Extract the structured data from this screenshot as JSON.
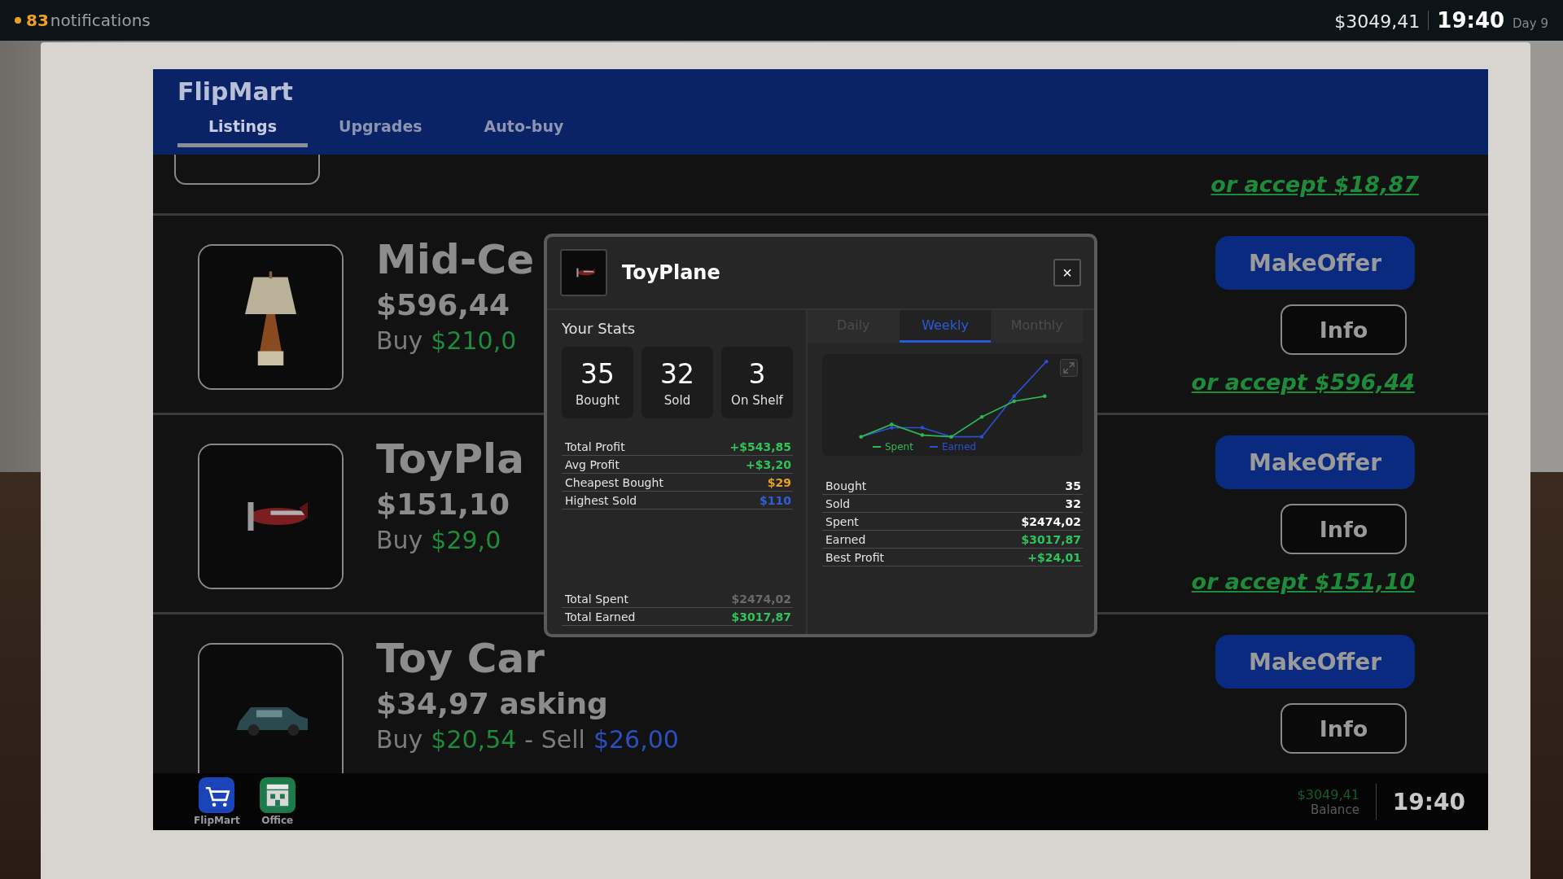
{
  "hud": {
    "notification_count": "83",
    "notification_label": "notifications",
    "balance": "$3049,41",
    "time": "19:40",
    "day": "Day 9"
  },
  "app": {
    "title": "FlipMart",
    "tabs": [
      {
        "label": "Listings",
        "selected": true
      },
      {
        "label": "Upgrades",
        "selected": false
      },
      {
        "label": "Auto-buy",
        "selected": false
      }
    ]
  },
  "listings": [
    {
      "kind": "partial",
      "accept": "or accept $18,87"
    },
    {
      "kind": "full",
      "title": "Mid-Ce",
      "price": "$596,44",
      "buy_line": [
        {
          "kind": "label",
          "text": "Buy"
        },
        {
          "kind": "buy",
          "text": "$210,0"
        }
      ],
      "offer_button": "MakeOffer",
      "info_button": "Info",
      "accept": "or accept $596,44"
    },
    {
      "kind": "full",
      "title": "ToyPla",
      "price": "$151,10",
      "buy_line": [
        {
          "kind": "label",
          "text": "Buy"
        },
        {
          "kind": "buy",
          "text": "$29,0"
        }
      ],
      "offer_button": "MakeOffer",
      "info_button": "Info",
      "accept": "or accept $151,10"
    },
    {
      "kind": "full",
      "title": "Toy Car",
      "price": "$34,97 asking",
      "buy_line": [
        {
          "kind": "label",
          "text": "Buy"
        },
        {
          "kind": "buy",
          "text": "$20,54"
        },
        {
          "kind": "label",
          "text": "- Sell"
        },
        {
          "kind": "sell",
          "text": "$26,00"
        }
      ],
      "offer_button": "MakeOffer",
      "info_button": "Info"
    }
  ],
  "dialog": {
    "title": "ToyPlane",
    "close": "×",
    "stats_heading": "Your Stats",
    "stat_cards": [
      {
        "value": "35",
        "label": "Bought"
      },
      {
        "value": "32",
        "label": "Sold"
      },
      {
        "value": "3",
        "label": "On Shelf"
      }
    ],
    "stats": [
      {
        "label": "Total Profit",
        "value": "+$543,85",
        "color": "#2fc45a"
      },
      {
        "label": "Avg Profit",
        "value": "+$3,20",
        "color": "#2fc45a"
      },
      {
        "label": "Cheapest Bought",
        "value": "$29",
        "color": "#e8a020"
      },
      {
        "label": "Highest Sold",
        "value": "$110",
        "color": "#2f5fd8"
      }
    ],
    "totals": [
      {
        "label": "Total Spent",
        "value": "$2474,02",
        "color": "#6a6a6a"
      },
      {
        "label": "Total Earned",
        "value": "$3017,87",
        "color": "#2fc45a"
      }
    ],
    "period_tabs": [
      {
        "label": "Daily",
        "selected": false
      },
      {
        "label": "Weekly",
        "selected": true
      },
      {
        "label": "Monthly",
        "selected": false
      }
    ],
    "chart_legend": [
      {
        "label": "Spent",
        "color": "#2fb850"
      },
      {
        "label": "Earned",
        "color": "#2a4fd0"
      }
    ],
    "period_stats": [
      {
        "label": "Bought",
        "value": "35",
        "color": "#ffffff"
      },
      {
        "label": "Sold",
        "value": "32",
        "color": "#ffffff"
      },
      {
        "label": "Spent",
        "value": "$2474,02",
        "color": "#ffffff"
      },
      {
        "label": "Earned",
        "value": "$3017,87",
        "color": "#2fc45a"
      },
      {
        "label": "Best Profit",
        "value": "+$24,01",
        "color": "#2fc45a"
      }
    ]
  },
  "taskbar": {
    "apps": [
      {
        "kind": "cart",
        "label": "FlipMart"
      },
      {
        "kind": "office",
        "label": "Office"
      }
    ],
    "balance": "$3049,41",
    "balance_label": "Balance",
    "time": "19:40"
  }
}
